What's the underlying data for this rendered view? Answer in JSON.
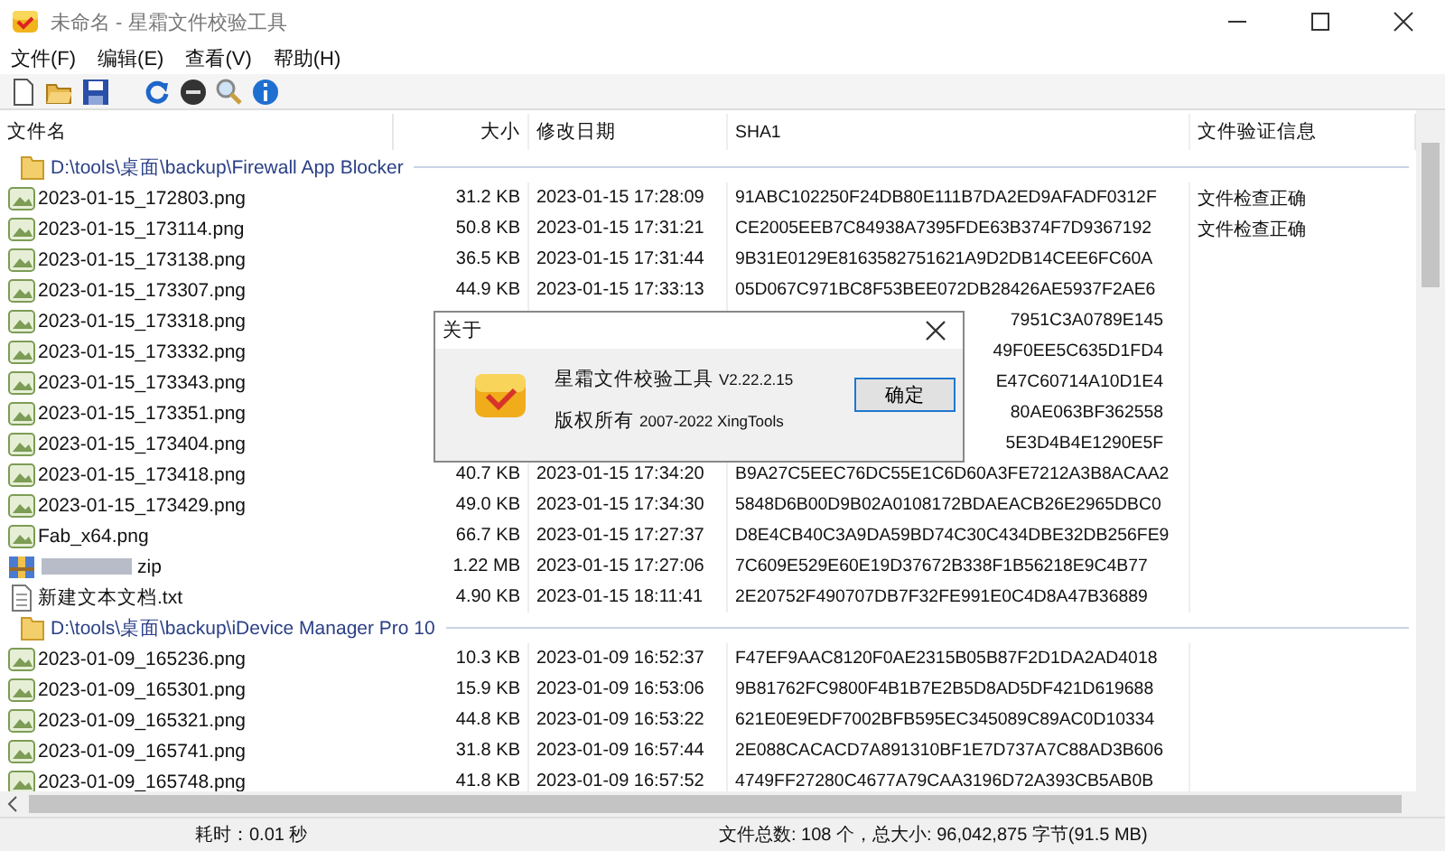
{
  "window": {
    "title": "未命名 - 星霜文件校验工具"
  },
  "menu": [
    "文件(F)",
    "编辑(E)",
    "查看(V)",
    "帮助(H)"
  ],
  "table": {
    "columns": [
      {
        "label": "文件名",
        "kind": "name"
      },
      {
        "label": "大小",
        "kind": "size"
      },
      {
        "label": "修改日期",
        "kind": "date"
      },
      {
        "label": "SHA1",
        "kind": "sha"
      },
      {
        "label": "文件验证信息",
        "kind": "info"
      }
    ],
    "rows": [
      {
        "kind": "folder",
        "name": "D:\\tools\\桌面\\backup\\Firewall App Blocker"
      },
      {
        "kind": "image",
        "name": "2023-01-15_172803.png",
        "size": "31.2 KB",
        "date": "2023-01-15 17:28:09",
        "sha": "91ABC102250F24DB80E111B7DA2ED9AFADF0312F",
        "info": "文件检查正确"
      },
      {
        "kind": "image",
        "name": "2023-01-15_173114.png",
        "size": "50.8 KB",
        "date": "2023-01-15 17:31:21",
        "sha": "CE2005EEB7C84938A7395FDE63B374F7D9367192",
        "info": "文件检查正确"
      },
      {
        "kind": "image",
        "name": "2023-01-15_173138.png",
        "size": "36.5 KB",
        "date": "2023-01-15 17:31:44",
        "sha": "9B31E0129E8163582751621A9D2DB14CEE6FC60A"
      },
      {
        "kind": "image",
        "name": "2023-01-15_173307.png",
        "size": "44.9 KB",
        "date": "2023-01-15 17:33:13",
        "sha": "05D067C971BC8F53BEE072DB28426AE5937F2AE6"
      },
      {
        "kind": "image",
        "name": "2023-01-15_173318.png",
        "sha_tail": "7951C3A0789E145"
      },
      {
        "kind": "image",
        "name": "2023-01-15_173332.png",
        "sha_tail": "49F0EE5C635D1FD4"
      },
      {
        "kind": "image",
        "name": "2023-01-15_173343.png",
        "sha_tail": "E47C60714A10D1E4"
      },
      {
        "kind": "image",
        "name": "2023-01-15_173351.png",
        "sha_tail": "80AE063BF362558"
      },
      {
        "kind": "image",
        "name": "2023-01-15_173404.png",
        "sha_tail": "5E3D4B4E1290E5F"
      },
      {
        "kind": "image",
        "name": "2023-01-15_173418.png",
        "size": "40.7 KB",
        "date": "2023-01-15 17:34:20",
        "sha": "B9A27C5EEC76DC55E1C6D60A3FE7212A3B8ACAA2"
      },
      {
        "kind": "image",
        "name": "2023-01-15_173429.png",
        "size": "49.0 KB",
        "date": "2023-01-15 17:34:30",
        "sha": "5848D6B00D9B02A0108172BDAEACB26E2965DBC0"
      },
      {
        "kind": "image",
        "name": "Fab_x64.png",
        "size": "66.7 KB",
        "date": "2023-01-15 17:27:37",
        "sha": "D8E4CB40C3A9DA59BD74C30C434DBE32DB256FE9"
      },
      {
        "kind": "zip",
        "name": "zip",
        "size": "1.22 MB",
        "date": "2023-01-15 17:27:06",
        "sha": "7C609E529E60E19D37672B338F1B56218E9C4B77"
      },
      {
        "kind": "text",
        "name": "新建文本文档.txt",
        "size": "4.90 KB",
        "date": "2023-01-15 18:11:41",
        "sha": "2E20752F490707DB7F32FE991E0C4D8A47B36889"
      },
      {
        "kind": "folder",
        "name": "D:\\tools\\桌面\\backup\\iDevice Manager Pro 10"
      },
      {
        "kind": "image",
        "name": "2023-01-09_165236.png",
        "size": "10.3 KB",
        "date": "2023-01-09 16:52:37",
        "sha": "F47EF9AAC8120F0AE2315B05B87F2D1DA2AD4018"
      },
      {
        "kind": "image",
        "name": "2023-01-09_165301.png",
        "size": "15.9 KB",
        "date": "2023-01-09 16:53:06",
        "sha": "9B81762FC9800F4B1B7E2B5D8AD5DF421D619688"
      },
      {
        "kind": "image",
        "name": "2023-01-09_165321.png",
        "size": "44.8 KB",
        "date": "2023-01-09 16:53:22",
        "sha": "621E0E9EDF7002BFB595EC345089C89AC0D10334"
      },
      {
        "kind": "image",
        "name": "2023-01-09_165741.png",
        "size": "31.8 KB",
        "date": "2023-01-09 16:57:44",
        "sha": "2E088CACACD7A891310BF1E7D737A7C88AD3B606"
      },
      {
        "kind": "image",
        "name": "2023-01-09_165748.png",
        "size": "41.8 KB",
        "date": "2023-01-09 16:57:52",
        "sha": "4749FF27280C4677A79CAA3196D72A393CB5AB0B"
      }
    ]
  },
  "dialog": {
    "title": "关于",
    "app_name": "星霜文件校验工具",
    "version": "V2.22.2.15",
    "copyright_label": "版权所有",
    "copyright": "2007-2022 XingTools",
    "button": "确定"
  },
  "status_bar": [
    "耗时：0.01 秒",
    "文件总数: 108 个，总大小: 96,042,875 字节(91.5 MB)"
  ]
}
